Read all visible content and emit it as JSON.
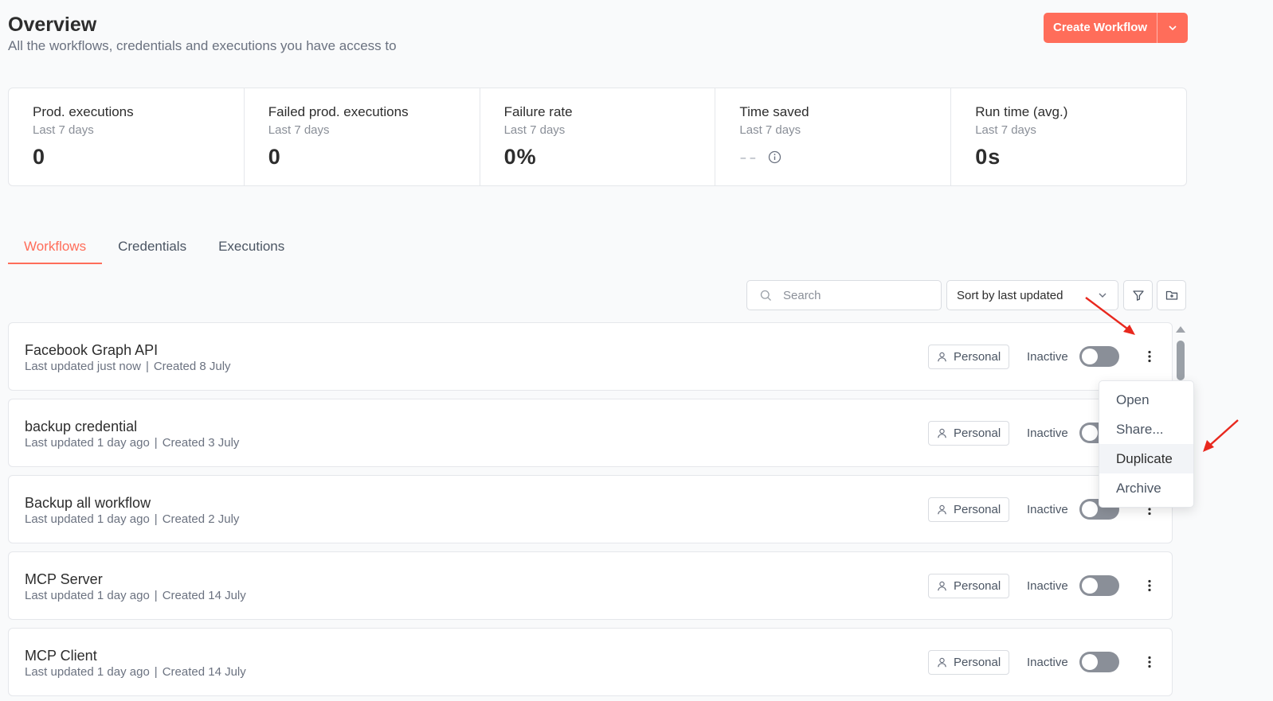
{
  "header": {
    "title": "Overview",
    "subtitle": "All the workflows, credentials and executions you have access to",
    "create_label": "Create Workflow"
  },
  "stats": [
    {
      "title": "Prod. executions",
      "sub": "Last 7 days",
      "value": "0"
    },
    {
      "title": "Failed prod. executions",
      "sub": "Last 7 days",
      "value": "0"
    },
    {
      "title": "Failure rate",
      "sub": "Last 7 days",
      "value": "0%"
    },
    {
      "title": "Time saved",
      "sub": "Last 7 days",
      "value": "--"
    },
    {
      "title": "Run time (avg.)",
      "sub": "Last 7 days",
      "value": "0s"
    }
  ],
  "tabs": [
    {
      "label": "Workflows",
      "active": true
    },
    {
      "label": "Credentials",
      "active": false
    },
    {
      "label": "Executions",
      "active": false
    }
  ],
  "toolbar": {
    "search_placeholder": "Search",
    "sort_label": "Sort by last updated"
  },
  "workflows": [
    {
      "name": "Facebook Graph API",
      "updated": "Last updated just now",
      "created": "Created 8 July",
      "owner": "Personal",
      "status": "Inactive"
    },
    {
      "name": "backup credential",
      "updated": "Last updated 1 day ago",
      "created": "Created 3 July",
      "owner": "Personal",
      "status": "Inactive"
    },
    {
      "name": "Backup all workflow",
      "updated": "Last updated 1 day ago",
      "created": "Created 2 July",
      "owner": "Personal",
      "status": "Inactive"
    },
    {
      "name": "MCP Server",
      "updated": "Last updated 1 day ago",
      "created": "Created 14 July",
      "owner": "Personal",
      "status": "Inactive"
    },
    {
      "name": "MCP Client",
      "updated": "Last updated 1 day ago",
      "created": "Created 14 July",
      "owner": "Personal",
      "status": "Inactive"
    }
  ],
  "row_separator": "|",
  "context_menu": {
    "items": [
      {
        "label": "Open",
        "highlighted": false
      },
      {
        "label": "Share...",
        "highlighted": false
      },
      {
        "label": "Duplicate",
        "highlighted": true
      },
      {
        "label": "Archive",
        "highlighted": false
      }
    ]
  },
  "colors": {
    "accent": "#ff6d5a",
    "annotation": "#e8281e"
  }
}
